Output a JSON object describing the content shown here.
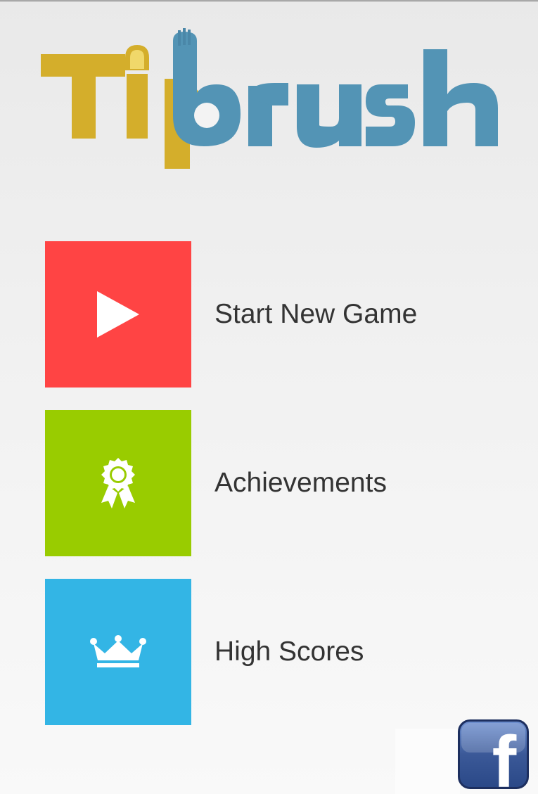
{
  "app": {
    "logo_part1": "Tip",
    "logo_part2": "brush",
    "logo_alt": "Tipbrush"
  },
  "menu": {
    "items": [
      {
        "label": "Start New Game",
        "color": "#ff4444",
        "icon": "play-icon"
      },
      {
        "label": "Achievements",
        "color": "#99cc00",
        "icon": "award-ribbon-icon"
      },
      {
        "label": "High Scores",
        "color": "#33b5e5",
        "icon": "crown-icon"
      }
    ]
  },
  "social": {
    "facebook_icon": "facebook-icon",
    "facebook_glyph": "f",
    "facebook_color": "#3b5998"
  },
  "colors": {
    "logo_gold": "#d4ae2b",
    "logo_blue": "#5394b5"
  }
}
